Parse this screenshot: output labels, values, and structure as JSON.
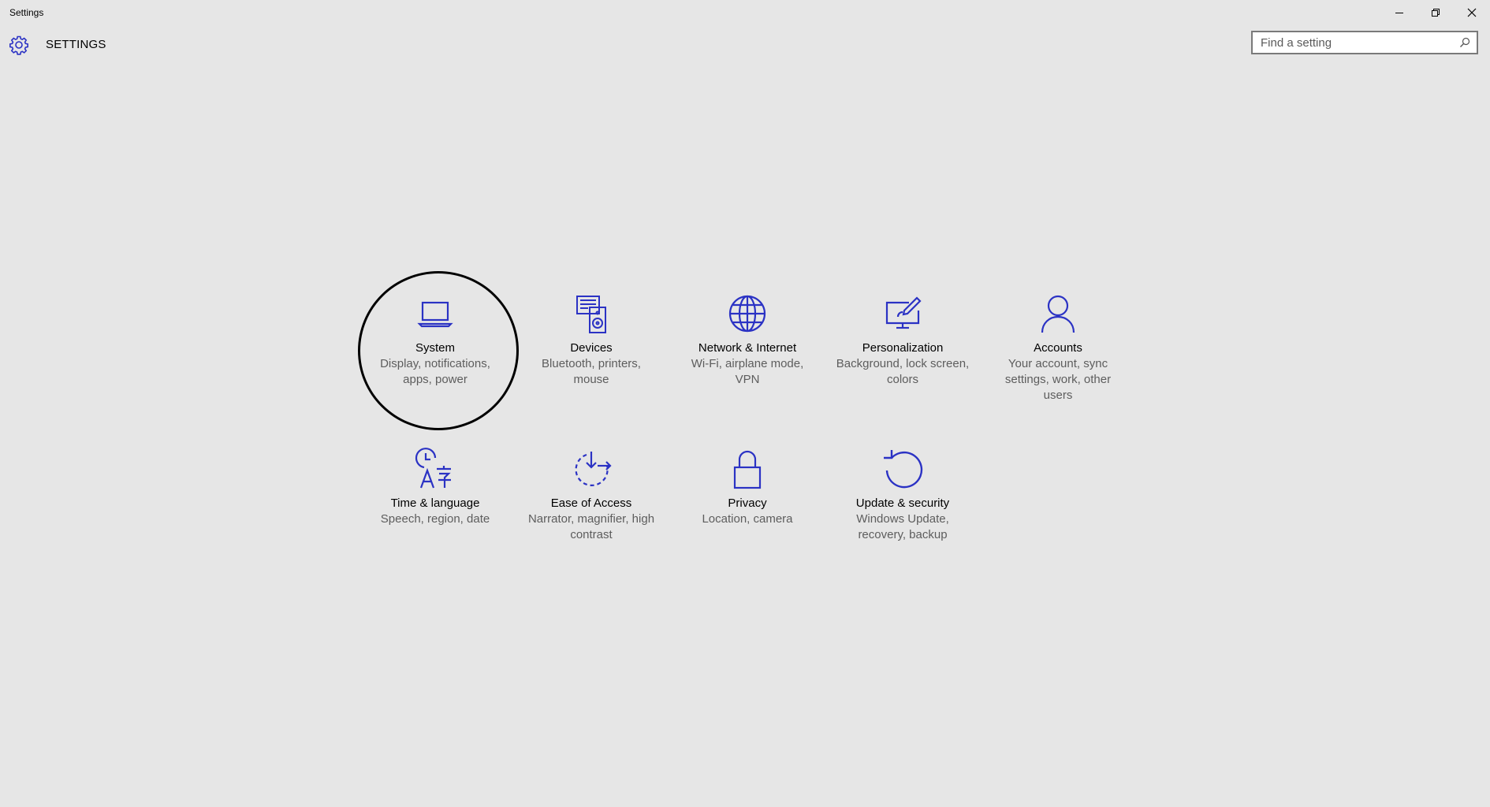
{
  "window": {
    "title": "Settings"
  },
  "header": {
    "title": "SETTINGS",
    "icon": "gear-icon"
  },
  "search": {
    "placeholder": "Find a setting",
    "value": ""
  },
  "colors": {
    "accent": "#2b32c4",
    "background": "#e6e6e6",
    "description": "#5d5d5d"
  },
  "tiles": [
    {
      "id": "system",
      "icon": "laptop-icon",
      "label": "System",
      "description": "Display, notifications, apps, power"
    },
    {
      "id": "devices",
      "icon": "devices-icon",
      "label": "Devices",
      "description": "Bluetooth, printers, mouse"
    },
    {
      "id": "network",
      "icon": "globe-icon",
      "label": "Network & Internet",
      "description": "Wi-Fi, airplane mode, VPN"
    },
    {
      "id": "personalization",
      "icon": "paintbrush-icon",
      "label": "Personalization",
      "description": "Background, lock screen, colors"
    },
    {
      "id": "accounts",
      "icon": "person-icon",
      "label": "Accounts",
      "description": "Your account, sync settings, work, other users"
    },
    {
      "id": "time-language",
      "icon": "time-language-icon",
      "label": "Time & language",
      "description": "Speech, region, date"
    },
    {
      "id": "ease-of-access",
      "icon": "ease-of-access-icon",
      "label": "Ease of Access",
      "description": "Narrator, magnifier, high contrast"
    },
    {
      "id": "privacy",
      "icon": "lock-icon",
      "label": "Privacy",
      "description": "Location, camera"
    },
    {
      "id": "update-security",
      "icon": "refresh-icon",
      "label": "Update & security",
      "description": "Windows Update, recovery, backup"
    }
  ]
}
